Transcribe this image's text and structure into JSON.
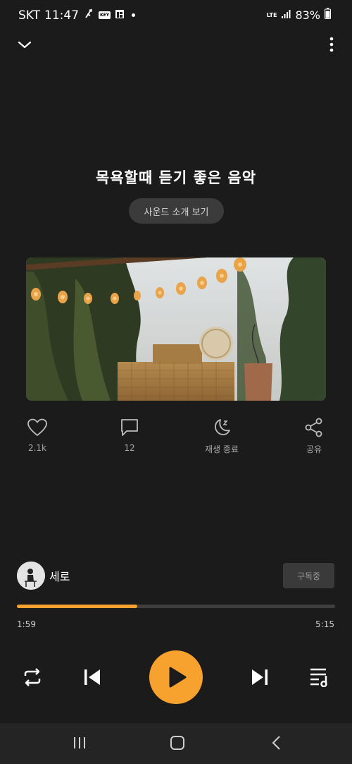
{
  "status_bar": {
    "carrier": "SKT",
    "time": "11:47",
    "key_badge": "KEY",
    "network": "LTE",
    "battery": "83%"
  },
  "player": {
    "title": "목욕할때 듣기 좋은 음악",
    "intro_button": "사운드 소개 보기",
    "actions": {
      "like_count": "2.1k",
      "comment_count": "12",
      "sleep_timer_label": "재생 종료",
      "share_label": "공유"
    },
    "artist": {
      "name": "세로",
      "subscribe_label": "구독중"
    },
    "progress": {
      "current": "1:59",
      "total": "5:15",
      "fraction": 0.378
    }
  },
  "colors": {
    "background": "#1b1b1b",
    "accent": "#f7a22e"
  },
  "icons": [
    "chevron-down-icon",
    "more-vert-icon",
    "heart-icon",
    "comment-icon",
    "moon-zz-icon",
    "share-icon",
    "repeat-icon",
    "skip-previous-icon",
    "play-icon",
    "skip-next-icon",
    "playlist-icon"
  ]
}
